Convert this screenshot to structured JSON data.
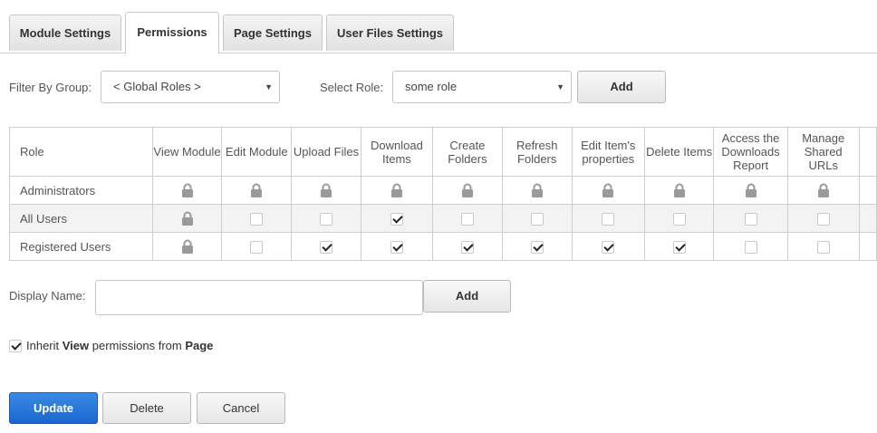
{
  "tabs": [
    "Module Settings",
    "Permissions",
    "Page Settings",
    "User Files Settings"
  ],
  "active_tab": "Permissions",
  "filter": {
    "group_label": "Filter By Group:",
    "group_value": "< Global Roles >",
    "role_label": "Select Role:",
    "role_value": "some role",
    "add_label": "Add"
  },
  "table": {
    "role_header": "Role",
    "columns": [
      "View Module",
      "Edit Module",
      "Upload Files",
      "Download Items",
      "Create Folders",
      "Refresh Folders",
      "Edit Item's properties",
      "Delete Items",
      "Access the Downloads Report",
      "Manage Shared URLs"
    ],
    "rows": [
      {
        "role": "Administrators",
        "cells": [
          "lock",
          "lock",
          "lock",
          "lock",
          "lock",
          "lock",
          "lock",
          "lock",
          "lock",
          "lock"
        ]
      },
      {
        "role": "All Users",
        "cells": [
          "lock",
          "off",
          "off",
          "on",
          "off",
          "off",
          "off",
          "off",
          "off",
          "off"
        ]
      },
      {
        "role": "Registered Users",
        "cells": [
          "lock",
          "off",
          "on",
          "on",
          "on",
          "on",
          "on",
          "on",
          "off",
          "off"
        ]
      }
    ]
  },
  "display_name": {
    "label": "Display Name:",
    "value": "",
    "add_label": "Add"
  },
  "inherit": {
    "checked": true,
    "text_pre": "Inherit ",
    "text_bold1": "View",
    "text_mid": " permissions from ",
    "text_bold2": "Page"
  },
  "actions": {
    "update_label": "Update",
    "delete_label": "Delete",
    "cancel_label": "Cancel"
  },
  "colors": {
    "primary": "#1f6fd6",
    "lock": "#9a9a9a"
  },
  "icons": {
    "lock": "lock-icon",
    "select_arrow": "caret-down-icon",
    "check": "checkmark-icon"
  }
}
